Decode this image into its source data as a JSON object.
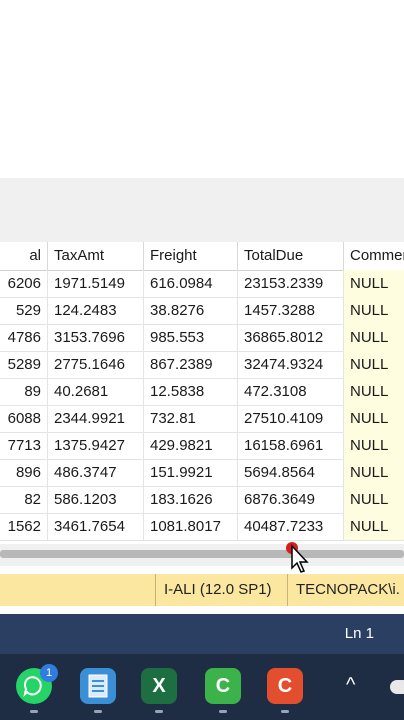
{
  "grid": {
    "columns": [
      "al",
      "TaxAmt",
      "Freight",
      "TotalDue",
      "Commer"
    ],
    "rows": [
      [
        "6206",
        "1971.5149",
        "616.0984",
        "23153.2339",
        "NULL"
      ],
      [
        "529",
        "124.2483",
        "38.8276",
        "1457.3288",
        "NULL"
      ],
      [
        "4786",
        "3153.7696",
        "985.553",
        "36865.8012",
        "NULL"
      ],
      [
        "5289",
        "2775.1646",
        "867.2389",
        "32474.9324",
        "NULL"
      ],
      [
        "89",
        "40.2681",
        "12.5838",
        "472.3108",
        "NULL"
      ],
      [
        "6088",
        "2344.9921",
        "732.81",
        "27510.4109",
        "NULL"
      ],
      [
        "7713",
        "1375.9427",
        "429.9821",
        "16158.6961",
        "NULL"
      ],
      [
        "896",
        "486.3747",
        "151.9921",
        "5694.8564",
        "NULL"
      ],
      [
        "82",
        "586.1203",
        "183.1626",
        "6876.3649",
        "NULL"
      ],
      [
        "1562",
        "3461.7654",
        "1081.8017",
        "40487.7233",
        "NULL"
      ]
    ]
  },
  "status": {
    "server": "I-ALI (12.0 SP1)",
    "user": "TECNOPACK\\i."
  },
  "editor": {
    "line": "Ln 1"
  },
  "taskbar": {
    "whatsapp_badge": "1",
    "apps": [
      "whatsapp-icon",
      "notepad-icon",
      "excel-icon",
      "camtasia-recorder-icon",
      "camtasia-editor-icon"
    ],
    "excel_glyph": "X",
    "camtasia_glyph": "C",
    "tray_chevron": "^"
  }
}
